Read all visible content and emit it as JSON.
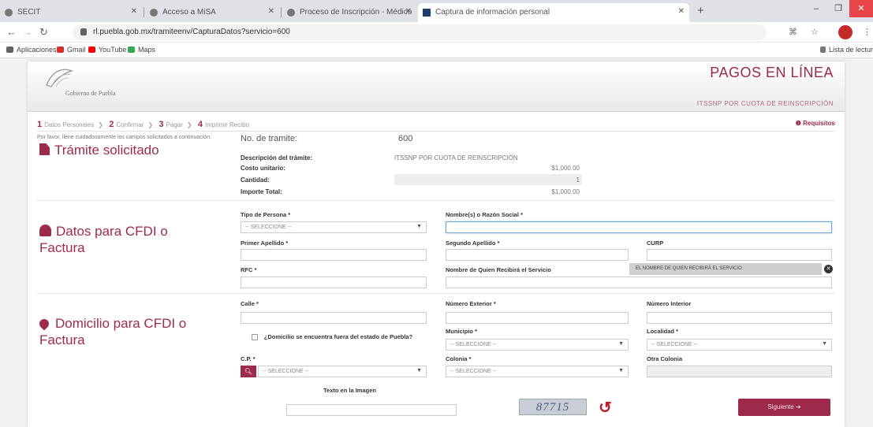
{
  "browser": {
    "tabs": [
      {
        "label": "SECIT"
      },
      {
        "label": "Acceso a MiSA"
      },
      {
        "label": "Proceso de Inscripción - Médico"
      },
      {
        "label": "Captura de información personal"
      }
    ],
    "new_tab": "+",
    "minimize": "–",
    "maximize": "❐",
    "close": "✕",
    "url": "rl.puebla.gob.mx/tramiteenv/CapturaDatos?servicio=600",
    "bookmarks": [
      {
        "label": "Aplicaciones",
        "color": "#5f6368"
      },
      {
        "label": "Gmail",
        "color": "#d93025"
      },
      {
        "label": "YouTube",
        "color": "#ff0000"
      },
      {
        "label": "Maps",
        "color": "#34a853"
      }
    ],
    "reading_list": "Lista de lectura"
  },
  "header": {
    "logo_text": "Gobierno de Puebla",
    "title": "PAGOS EN LÍNEA",
    "subtitle": "ITSSNP POR CUOTA DE REINSCRIPCIÓN"
  },
  "steps": [
    {
      "num": "1",
      "label": "Datos Personales"
    },
    {
      "num": "2",
      "label": "Confirmar"
    },
    {
      "num": "3",
      "label": "Pagar"
    },
    {
      "num": "4",
      "label": "Imprimir Recibo"
    }
  ],
  "requisitos_label": "Requisitos",
  "instructions": "Por favor, llene cuidadosamente los campos solicitados a continuación:",
  "tramite": {
    "section_title": "Trámite solicitado",
    "num_label": "No. de tramite:",
    "num_value": "600",
    "desc_label": "Descripción del trámite:",
    "desc_value": "ITSSNP POR CUOTA DE REINSCRIPCIÓN",
    "costo_label": "Costo unitario:",
    "costo_value": "$1,000.00",
    "cantidad_label": "Cantidad:",
    "cantidad_value": "1",
    "importe_label": "Importe Total:",
    "importe_value": "$1,000.00"
  },
  "cfdi": {
    "section_title": "Datos para CFDI o Factura",
    "tipo_persona_label": "Tipo de Persona *",
    "tipo_persona_value": "-- SELECCIONE --",
    "nombre_label": "Nombre(s) o Razón Social *",
    "nombre_value": "",
    "primer_apellido_label": "Primer Apellido *",
    "segundo_apellido_label": "Segundo Apellido *",
    "curp_label": "CURP",
    "rfc_label": "RFC *",
    "quien_recibira_label": "Nombre de Quien Recibirá el Servicio",
    "quien_recibira_tooltip": "EL NOMBRE DE QUIEN RECIBIRÁ EL SERVICIO"
  },
  "domicilio": {
    "section_title": "Domicilio para CFDI o Factura",
    "calle_label": "Calle *",
    "num_ext_label": "Número Exterior *",
    "num_int_label": "Número Interior",
    "fuera_label": "¿Domicilio se encuentra fuera del estado de Puebla?",
    "municipio_label": "Municipio *",
    "municipio_value": "-- SELECCIONE --",
    "localidad_label": "Localidad *",
    "localidad_value": "-- SELECCIONE --",
    "cp_label": "C.P. *",
    "cp_value": "-- SELECCIONE --",
    "colonia_label": "Colonia *",
    "colonia_value": "-- SELECCIONE --",
    "otra_colonia_label": "Otra Colonia"
  },
  "captcha": {
    "label": "Texto en la Imagen",
    "code": "87715"
  },
  "next_button": "Siguiente ➔",
  "colors": {
    "brand": "#9e2a4b",
    "refresh": "#c0192b"
  }
}
